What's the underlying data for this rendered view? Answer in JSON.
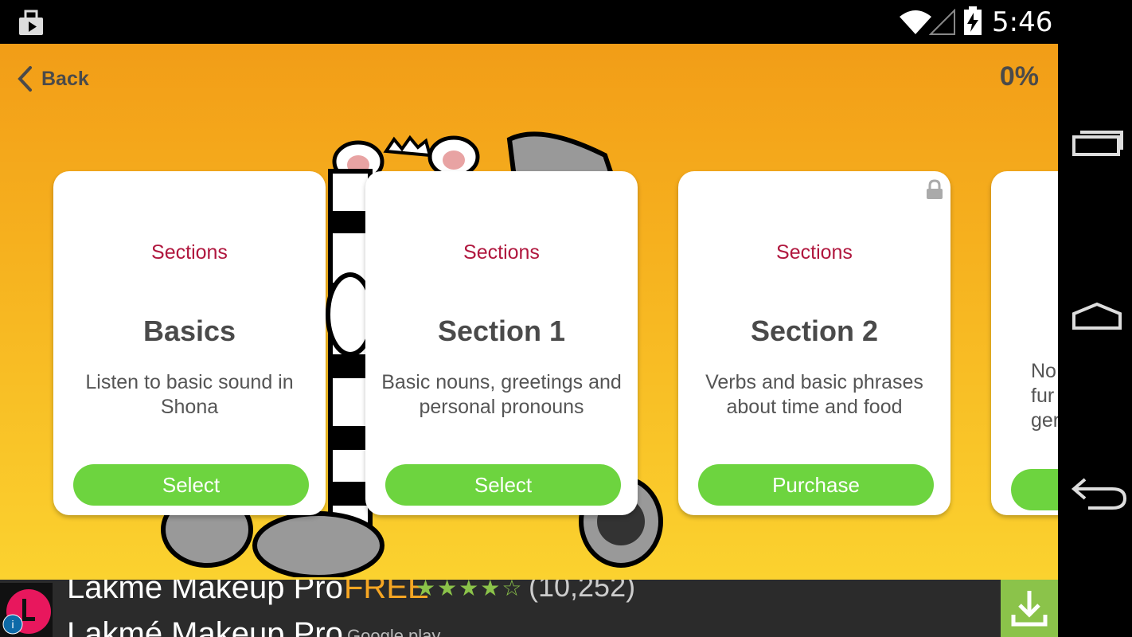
{
  "status_bar": {
    "time": "5:46",
    "icons": [
      "notification-icon",
      "wifi-icon",
      "signal-icon",
      "battery-charging-icon"
    ]
  },
  "nav_bar": {
    "icons": [
      "recents-icon",
      "home-icon",
      "back-icon"
    ]
  },
  "header": {
    "back_label": "Back",
    "progress": "0%"
  },
  "cards": [
    {
      "kicker": "Sections",
      "title": "Basics",
      "description": "Listen to basic sound in Shona",
      "button": "Select",
      "locked": false
    },
    {
      "kicker": "Sections",
      "title": "Section 1",
      "description": "Basic nouns, greetings and personal pronouns",
      "button": "Select",
      "locked": false
    },
    {
      "kicker": "Sections",
      "title": "Section 2",
      "description": "Verbs and basic phrases about time and food",
      "button": "Purchase",
      "locked": true
    },
    {
      "kicker": "",
      "title": "",
      "description": "No\nfur\nger",
      "button": "",
      "locked": false
    }
  ],
  "ad": {
    "title": "Lakme Makeup Pro",
    "price": "FREE",
    "stars": "★★★★☆",
    "rating_count": "(10,252)",
    "subtitle": "Lakmé Makeup Pro",
    "store": "Google play",
    "colors": {
      "download": "#8bc34a",
      "price": "#f6a623"
    }
  },
  "colors": {
    "accent_button": "#6dd43f",
    "kicker": "#b0173e",
    "background_top": "#f29d17",
    "background_bottom": "#fbd22f"
  }
}
